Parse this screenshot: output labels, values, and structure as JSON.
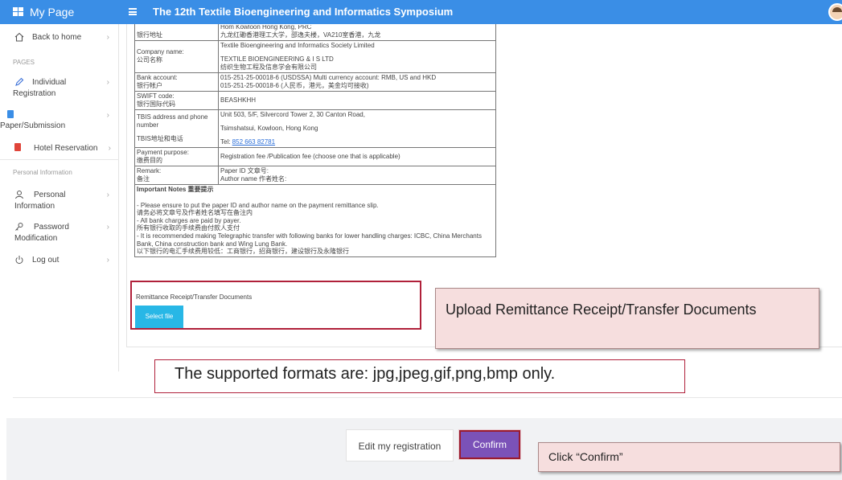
{
  "header": {
    "brand": "My Page",
    "title": "The 12th Textile Bioengineering and Informatics Symposium"
  },
  "sidebar": {
    "back": "Back to home",
    "section_pages": "PAGES",
    "items": [
      {
        "label": "Individual Registration"
      },
      {
        "label": "Paper/Submission"
      },
      {
        "label": "Hotel Reservation"
      }
    ],
    "section_personal": "Personal Information",
    "personal_items": [
      {
        "label": "Personal Information"
      },
      {
        "label": "Password Modification"
      },
      {
        "label": "Log out"
      }
    ]
  },
  "bank_table": {
    "address_top": "Hom Kowloon Hong Kong, PRC",
    "address_label_cn": "银行地址",
    "address_value_cn": "九龙红磡香港理工大学，邵逸夫楼，VA210室香港，九龙",
    "company_label": "Company name:",
    "company_label_cn": "公司名称",
    "company_value1": "Textile Bioengineering and Informatics Society Limited",
    "company_value2": "TEXTILE BIOENGINEERING & I S LTD",
    "company_value_cn": "纺织生物工程及信息学会有限公司",
    "bank_label": "Bank account:",
    "bank_label_cn": "银行帐户",
    "bank_value1": "015-251-25-00018-6 (USDSSA) Multi currency account: RMB, US and HKD",
    "bank_value2": "015-251-25-00018-6 (人民币，港元，美金均可接收)",
    "swift_label": "SWIFT code:",
    "swift_label_cn": "银行国际代码",
    "swift_value": "BEASHKHH",
    "tbis_label": "TBIS address and phone number",
    "tbis_label_cn": "TBIS地址和电话",
    "tbis_value1": "Unit 503, 5/F, Silvercord Tower 2, 30 Canton Road,",
    "tbis_value2": "Tsimshatsui, Kowloon, Hong Kong",
    "tbis_tel_prefix": "Tel: ",
    "tbis_tel": "852 663 82781",
    "purpose_label": "Payment purpose:",
    "purpose_label_cn": "缴费目的",
    "purpose_value": "Registration fee /Publication fee (choose one that is applicable)",
    "remark_label": "Remark:",
    "remark_label_cn": "备注",
    "remark_value1": "Paper ID 文章号:",
    "remark_value2": "Author name 作者姓名:",
    "notes_title": "Important Notes 重要提示",
    "notes": [
      "- Please ensure to put the paper ID and author name on the payment remittance slip.",
      "请务必将文章号及作者姓名填写在备注内",
      "- All bank charges are paid by payer.",
      "所有银行收取的手续费由付款人支付",
      "- It is recommended making Telegraphic transfer with following banks for lower handling charges: ICBC, China Merchants Bank, China construction bank and Wing Lung Bank.",
      "以下银行的电汇手续费用较低：工商银行，招商银行，建设银行及永隆银行"
    ]
  },
  "upload": {
    "label": "Remittance Receipt/Transfer Documents",
    "button": "Select file"
  },
  "callouts": {
    "upload": "Upload Remittance Receipt/Transfer Documents",
    "formats": "The supported formats are: jpg,jpeg,gif,png,bmp only.",
    "confirm": "Click “Confirm”"
  },
  "actions": {
    "edit": "Edit my registration",
    "confirm": "Confirm"
  },
  "colors": {
    "header": "#3a8ee6",
    "confirm": "#7b52b8",
    "select_file": "#28b7e6",
    "highlight_border": "#b0203a",
    "callout_bg": "#f6dede"
  }
}
